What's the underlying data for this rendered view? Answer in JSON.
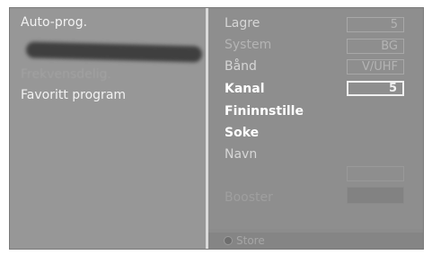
{
  "menu": {
    "items": [
      {
        "label": "Auto-prog."
      },
      {
        "label": "Frekvensdelig."
      },
      {
        "label": "Favoritt program"
      }
    ]
  },
  "settings": {
    "rows": [
      {
        "label": "Lagre",
        "value": "5"
      },
      {
        "label": "System",
        "value": "BG"
      },
      {
        "label": "Bånd",
        "value": "V/UHF"
      },
      {
        "label": "Kanal",
        "value": "5"
      },
      {
        "label": "Fininnstille"
      },
      {
        "label": "Soke"
      },
      {
        "label": "Navn"
      },
      {
        "label": "Booster"
      }
    ]
  },
  "footer": {
    "store_label": "Store"
  }
}
